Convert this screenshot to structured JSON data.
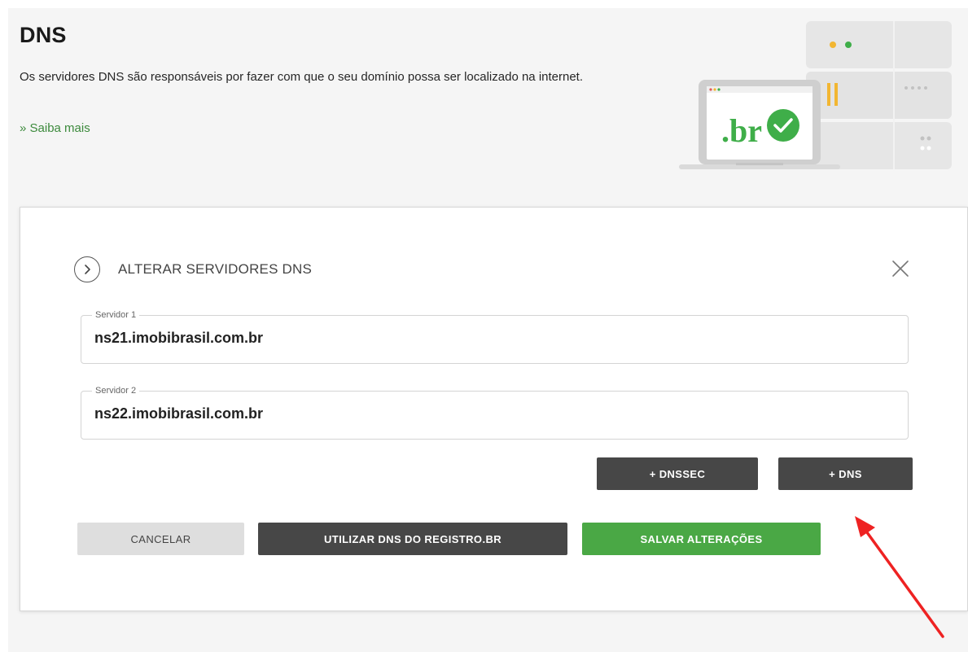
{
  "header": {
    "title": "DNS",
    "description": "Os servidores DNS são responsáveis por fazer com que o seu domínio possa ser localizado na internet.",
    "learn_more": "» Saiba mais",
    "illustration_text": ".br"
  },
  "dialog": {
    "title": "ALTERAR SERVIDORES DNS",
    "fields": [
      {
        "label": "Servidor 1",
        "value": "ns21.imobibrasil.com.br"
      },
      {
        "label": "Servidor 2",
        "value": "ns22.imobibrasil.com.br"
      }
    ],
    "buttons": {
      "add_dnssec": "+ DNSSEC",
      "add_dns": "+ DNS",
      "cancel": "CANCELAR",
      "use_registro_dns": "UTILIZAR DNS DO REGISTRO.BR",
      "save": "SALVAR ALTERAÇÕES"
    }
  },
  "colors": {
    "accent_green": "#4aa845",
    "dark_button": "#474747",
    "light_button": "#dedede",
    "annotation_arrow": "#ee2222"
  },
  "icons": {
    "dialog_toggle": "chevron-right-icon",
    "dialog_close": "close-icon",
    "server_check": "check-icon"
  }
}
